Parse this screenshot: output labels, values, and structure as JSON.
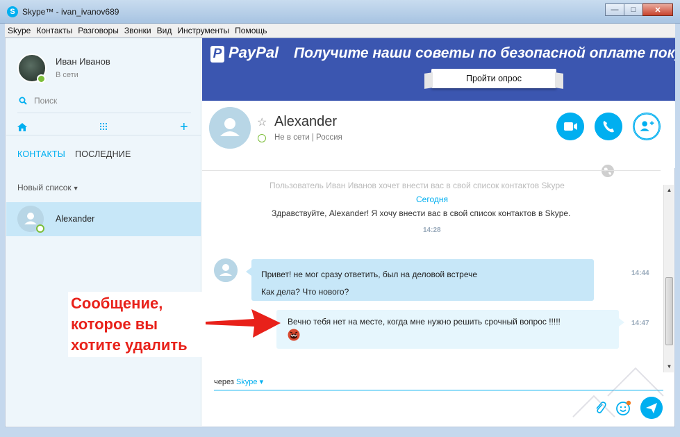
{
  "window": {
    "title": "Skype™ - ivan_ivanov689",
    "buttons": [
      "—",
      "□",
      "✕"
    ]
  },
  "menu": [
    "Skype",
    "Контакты",
    "Разговоры",
    "Звонки",
    "Вид",
    "Инструменты",
    "Помощь"
  ],
  "profile": {
    "name": "Иван Иванов",
    "presence": "В сети"
  },
  "sidebar": {
    "search_label": "Поиск",
    "tabs": [
      "КОНТАКТЫ",
      "ПОСЛЕДНИЕ"
    ],
    "list_filter": "Новый список",
    "contacts": [
      {
        "name": "Alexander"
      }
    ]
  },
  "banner": {
    "brand": "PayPal",
    "headline": "Получите наши советы по безопасной оплате покуп",
    "cta": "Пройти опрос"
  },
  "chat": {
    "contact_name": "Alexander",
    "status": "Не в сети | Россия",
    "system_faded": "Пользователь Иван Иванов хочет внести вас в свой список контактов Skype",
    "day_label": "Сегодня",
    "system_message": "Здравствуйте, Alexander! Я хочу внести вас в свой список контактов в Skype.",
    "system_time": "14:28",
    "incoming": {
      "lines": [
        "Привет! не мог сразу ответить, был на деловой встрече",
        "Как дела? Что нового?"
      ],
      "time": "14:44"
    },
    "outgoing": {
      "text": "Вечно тебя нет на месте, когда мне нужно решить срочный вопрос !!!!!",
      "time": "14:47"
    },
    "via_label": "через",
    "via_link": "Skype"
  },
  "annotation": {
    "lines": [
      "Сообщение,",
      "которое вы",
      "хотите удалить"
    ]
  },
  "colors": {
    "accent": "#00aff0",
    "online": "#7cbe3a",
    "annotation": "#e8211a",
    "banner_bg": "#3b56b0"
  }
}
